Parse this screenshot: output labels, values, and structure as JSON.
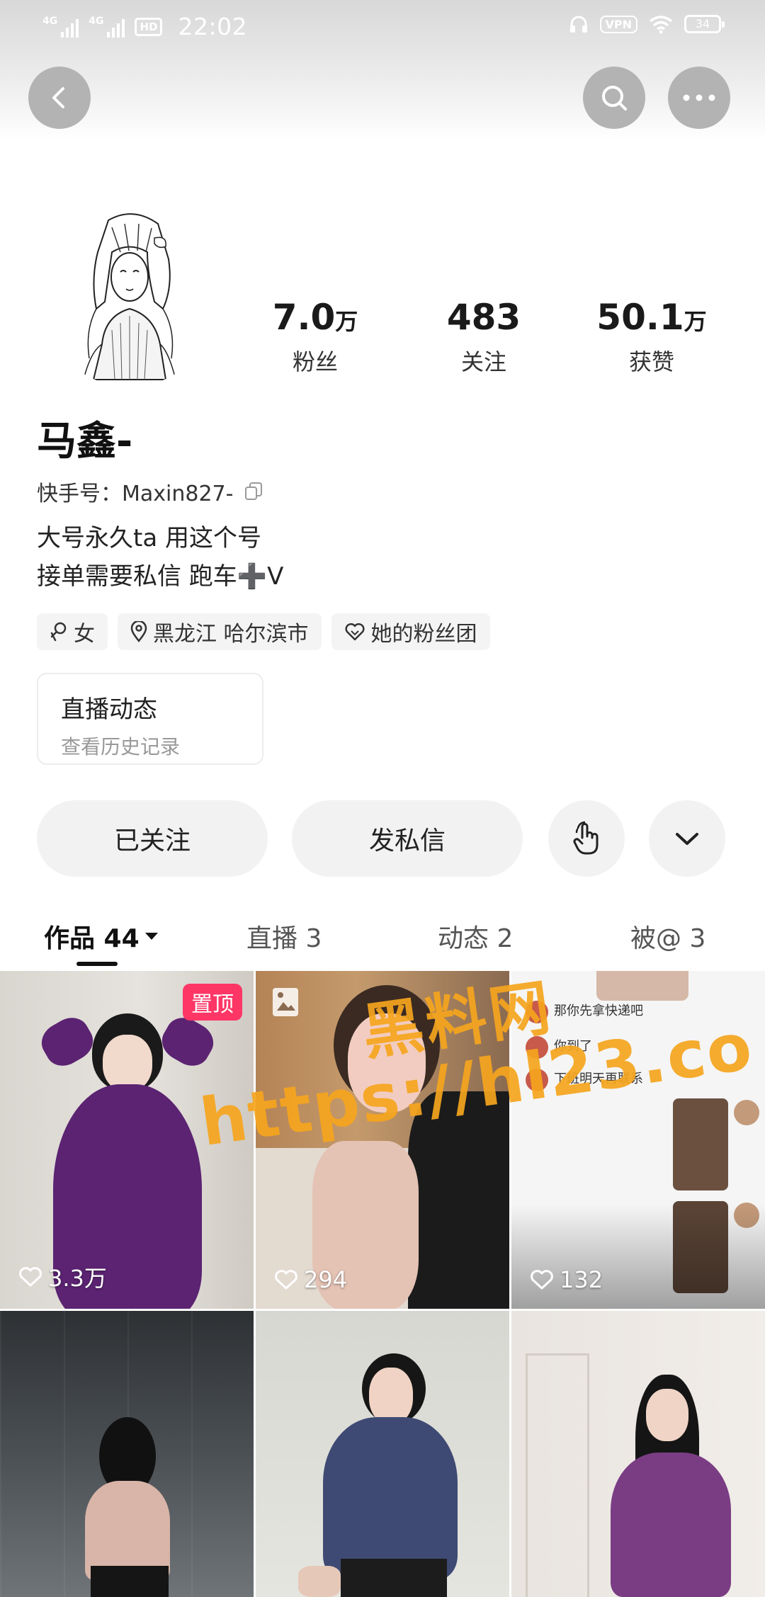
{
  "status_bar": {
    "network_1": "4G",
    "network_2": "4G",
    "hd_badge": "HD",
    "time": "22:02",
    "vpn": "VPN",
    "battery": "34"
  },
  "profile": {
    "name": "马鑫-",
    "kwai_id_label": "快手号：Maxin827-",
    "bio_line1": "大号永久ta 用这个号",
    "bio_line2": "接单需要私信 跑车➕V",
    "stats": [
      {
        "value": "7.0",
        "unit": "万",
        "label": "粉丝"
      },
      {
        "value": "483",
        "unit": "",
        "label": "关注"
      },
      {
        "value": "50.1",
        "unit": "万",
        "label": "获赞"
      }
    ],
    "tags": {
      "gender": "女",
      "location": "黑龙江 哈尔滨市",
      "fan_group": "她的粉丝团"
    },
    "live_card": {
      "title": "直播动态",
      "subtitle": "查看历史记录"
    }
  },
  "actions": {
    "follow_label": "已关注",
    "message_label": "发私信"
  },
  "tabs": [
    {
      "label": "作品 44"
    },
    {
      "label": "直播 3"
    },
    {
      "label": "动态 2"
    },
    {
      "label": "被@ 3"
    }
  ],
  "posts": [
    {
      "likes": "3.3万",
      "pinned": "置顶"
    },
    {
      "likes": "294"
    },
    {
      "likes": "132"
    },
    {
      "likes": ""
    },
    {
      "likes": ""
    },
    {
      "likes": ""
    }
  ],
  "screenshot_chat": {
    "line1": "那你先拿快递吧",
    "line2": "你到了",
    "line3": "下班明天再联系"
  },
  "watermark": {
    "site_name": "黑料网",
    "url": "https://hl23.co"
  },
  "colors": {
    "accent_pink": "#fe3666",
    "watermark_orange": "#f6a51e"
  }
}
